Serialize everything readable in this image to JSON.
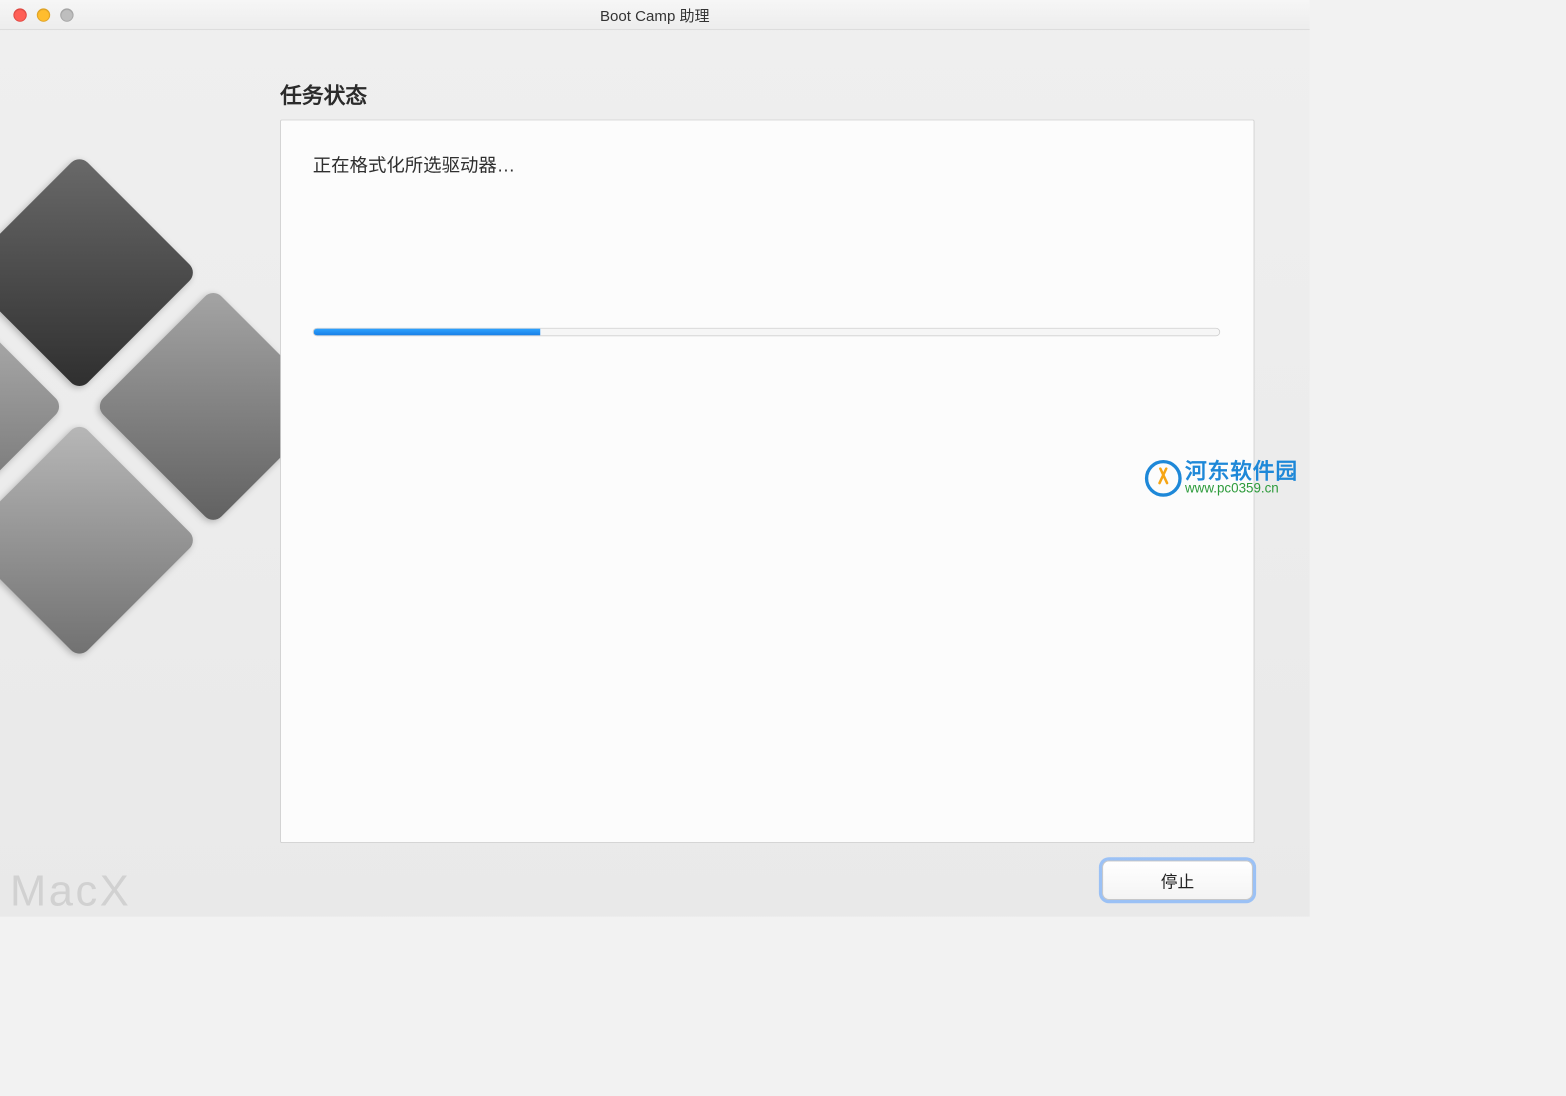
{
  "window": {
    "title": "Boot Camp 助理"
  },
  "heading": "任务状态",
  "status_message": "正在格式化所选驱动器…",
  "progress": {
    "percent": 25
  },
  "button": {
    "stop": "停止"
  },
  "watermark": {
    "name": "河东软件园",
    "url": "www.pc0359.cn"
  },
  "corner_mark": "MacX",
  "colors": {
    "progress_fill": "#1e8bf0",
    "accent_blue": "#1e88d8",
    "accent_green": "#2d9b3b",
    "accent_orange": "#f6a514"
  }
}
